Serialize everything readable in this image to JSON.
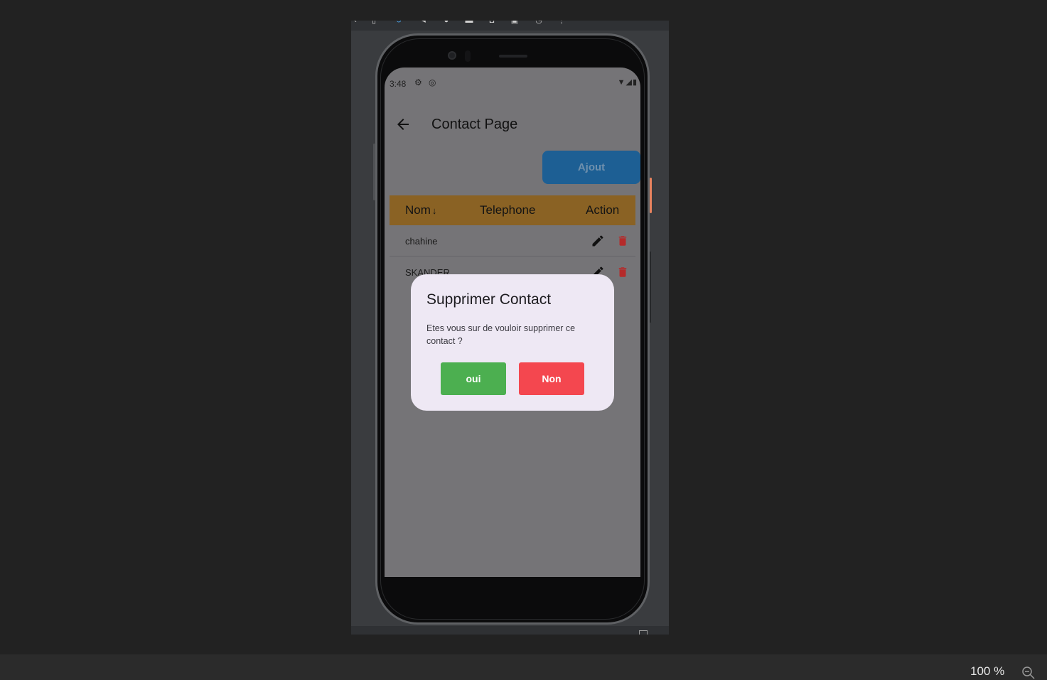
{
  "status_bar": {
    "time": "3:48",
    "left_icons": [
      "gear-icon",
      "at-icon"
    ],
    "right_icons": [
      "wifi-icon",
      "signal-icon",
      "battery-icon"
    ]
  },
  "app_bar": {
    "title": "Contact Page"
  },
  "actions": {
    "add_label": "Ajout"
  },
  "table": {
    "columns": [
      "Nom",
      "Telephone",
      "Action"
    ],
    "rows": [
      {
        "name": "chahine"
      },
      {
        "name": "SKANDER"
      }
    ]
  },
  "dialog": {
    "title": "Supprimer Contact",
    "message": "Etes vous sur de vouloir supprimer ce contact ?",
    "yes_label": "oui",
    "no_label": "Non"
  },
  "ide": {
    "zoom": "100 %"
  },
  "colors": {
    "header": "#8a6224",
    "add_button": "#1d5f94",
    "yes_button": "#4caf50",
    "no_button": "#f4474f",
    "delete_icon": "#b52a2a"
  }
}
